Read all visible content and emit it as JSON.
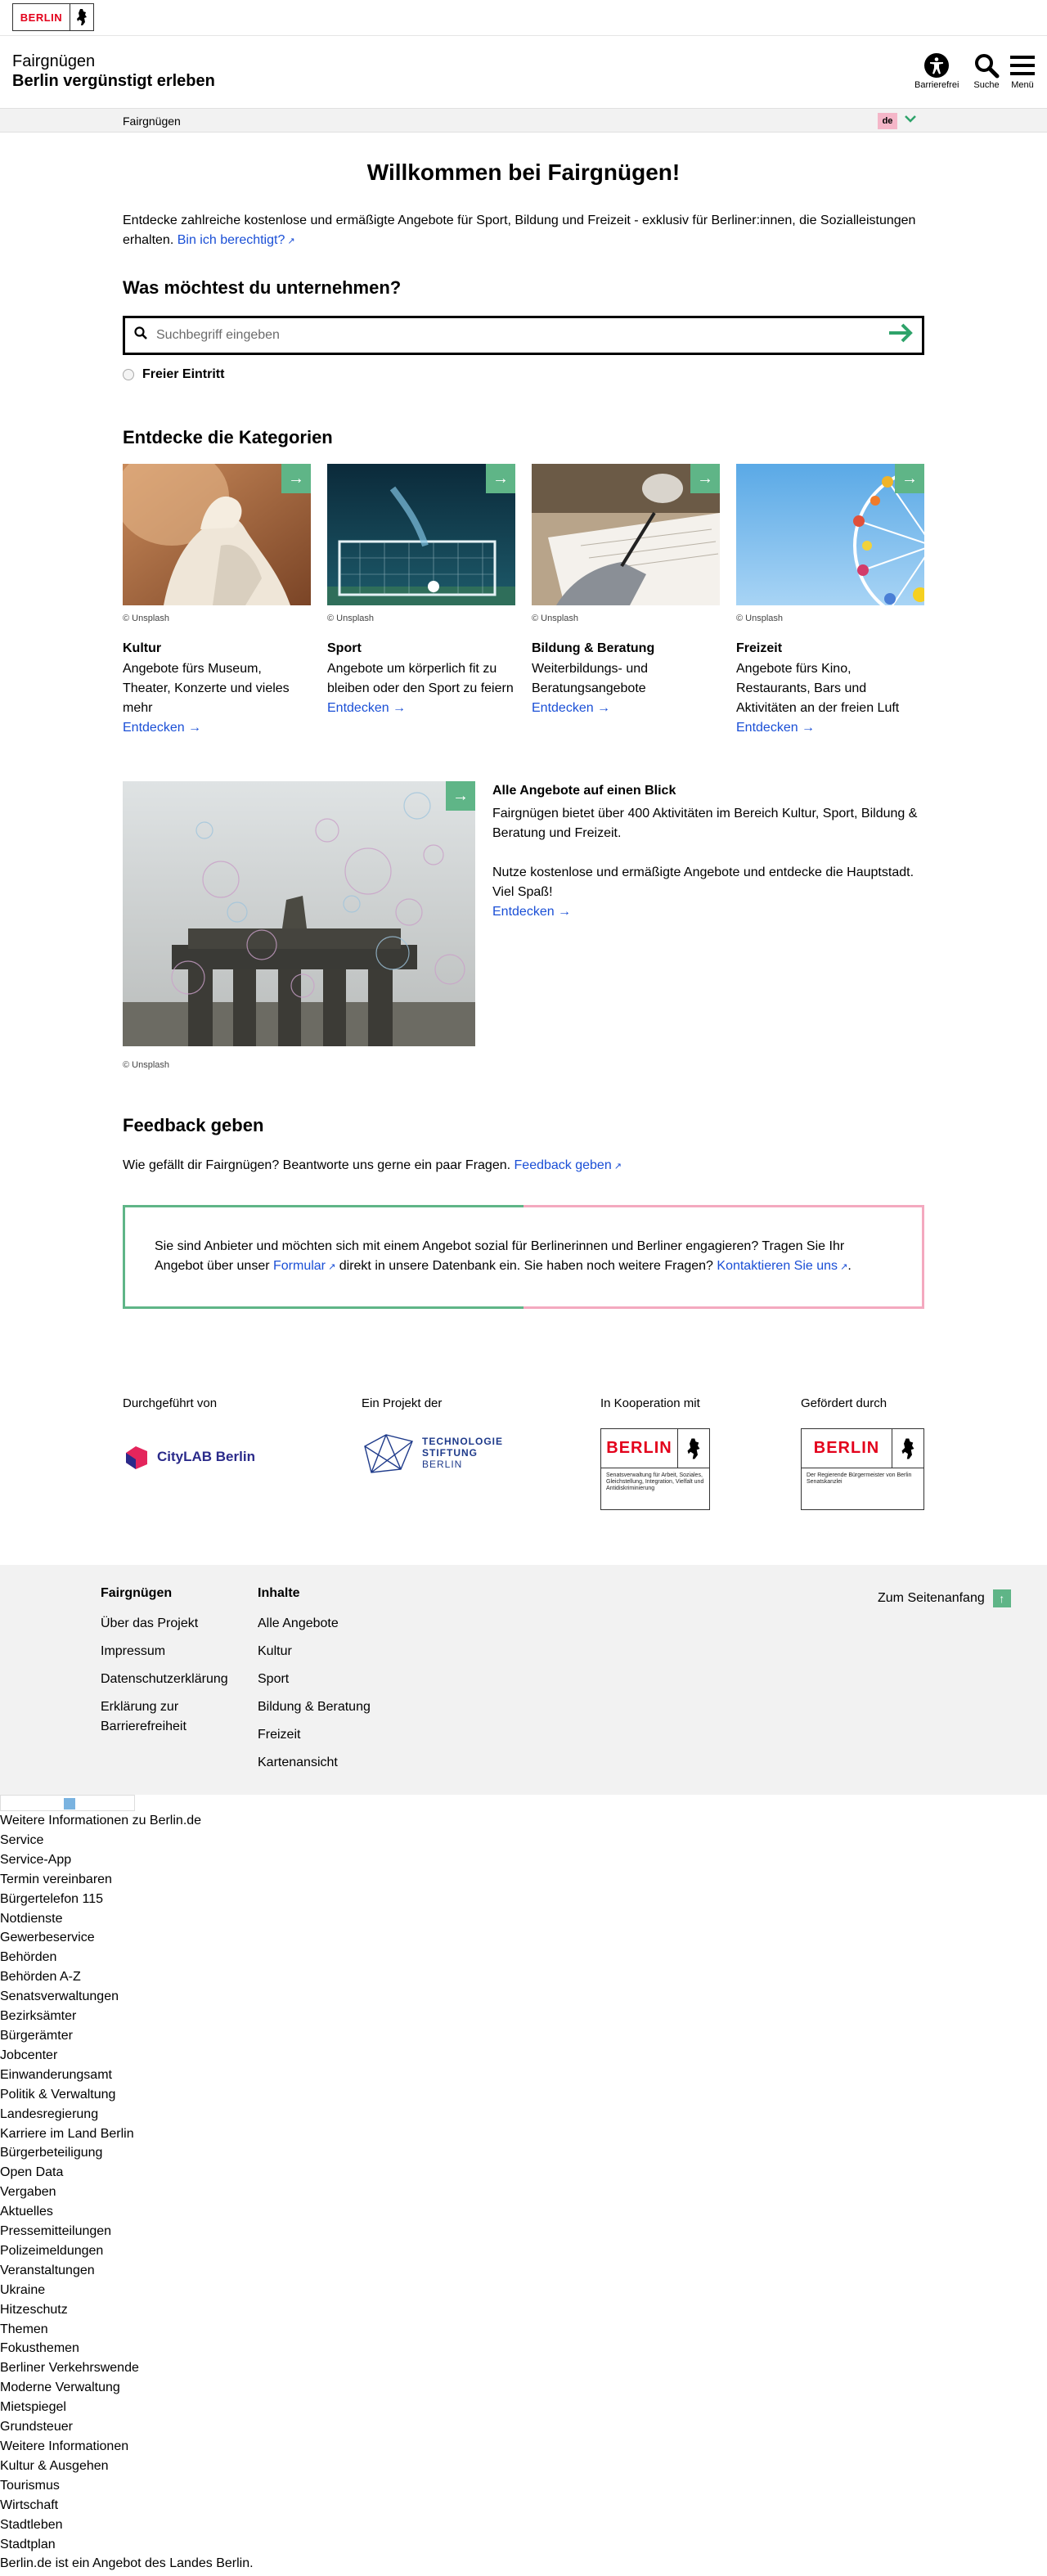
{
  "topbar": {
    "logo_word": "BERLIN"
  },
  "header": {
    "title": "Fairgnügen",
    "subtitle": "Berlin vergünstigt erleben",
    "buttons": {
      "accessibility": "Barrierefrei",
      "search": "Suche",
      "menu": "Menü"
    }
  },
  "breadcrumb": {
    "current": "Fairgnügen",
    "lang": "de"
  },
  "main": {
    "heading": "Willkommen bei Fairgnügen!",
    "intro": "Entdecke zahlreiche kostenlose und ermäßigte Angebote für Sport, Bildung und Freizeit - exklusiv für Berliner:innen, die Sozialleistungen erhalten.",
    "intro_link": "Bin ich berechtigt?",
    "search_heading": "Was möchtest du unternehmen?",
    "search_placeholder": "Suchbegriff eingeben",
    "free_entry_label": "Freier Eintritt",
    "categories_heading": "Entdecke die Kategorien"
  },
  "categories": [
    {
      "credit": "© Unsplash",
      "title": "Kultur",
      "desc": "Angebote fürs Museum, Theater, Konzerte und vieles mehr",
      "link": "Entdecken"
    },
    {
      "credit": "© Unsplash",
      "title": "Sport",
      "desc": "Angebote um körperlich fit zu bleiben oder den Sport zu feiern",
      "link": "Entdecken"
    },
    {
      "credit": "© Unsplash",
      "title": "Bildung & Beratung",
      "desc": "Weiterbildungs- und Beratungsangebote",
      "link": "Entdecken"
    },
    {
      "credit": "© Unsplash",
      "title": "Freizeit",
      "desc": "Angebote fürs Kino, Restaurants, Bars und Aktivitäten an der freien Luft",
      "link": "Entdecken"
    }
  ],
  "overview": {
    "credit": "© Unsplash",
    "title": "Alle Angebote auf einen Blick",
    "p1": "Fairgnügen bietet über 400 Aktivitäten im Bereich Kultur, Sport, Bildung & Beratung und Freizeit.",
    "p2": "Nutze kostenlose und ermäßigte Angebote und entdecke die Hauptstadt. Viel Spaß!",
    "link": "Entdecken"
  },
  "feedback": {
    "heading": "Feedback geben",
    "text": "Wie gefällt dir Fairgnügen? Beantworte uns gerne ein paar Fragen.",
    "link": "Feedback geben"
  },
  "provider_box": {
    "t1": "Sie sind Anbieter und möchten sich mit einem Angebot sozial für Berlinerinnen und Berliner engagieren? Tragen Sie Ihr Angebot über unser",
    "link1": "Formular",
    "t2": "direkt in unsere Datenbank ein. Sie haben noch weitere Fragen?",
    "link2": "Kontaktieren Sie uns",
    "t3": "."
  },
  "partners": {
    "label1": "Durchgeführt von",
    "citylab": "CityLAB Berlin",
    "label2": "Ein Projekt der",
    "tsb": [
      "TECHNOLOGIE",
      "STIFTUNG",
      "BERLIN"
    ],
    "label3": "In Kooperation mit",
    "coop_word": "BERLIN",
    "coop_text": "Senatsverwaltung für Arbeit, Soziales, Gleichstellung, Integration, Vielfalt und Antidiskriminierung",
    "label4": "Gefördert durch",
    "fund_word": "BERLIN",
    "fund_text": "Der Regierende Bürgermeister von Berlin Senatskanzlei"
  },
  "footer": {
    "col1_title": "Fairgnügen",
    "col1": [
      "Über das Projekt",
      "Impressum",
      "Datenschutzerklärung",
      "Erklärung zur Barrierefreiheit"
    ],
    "col2_title": "Inhalte",
    "col2": [
      "Alle Angebote",
      "Kultur",
      "Sport",
      "Bildung & Beratung",
      "Freizeit",
      "Kartenansicht"
    ],
    "to_top": "Zum Seitenanfang"
  },
  "berlin_links": [
    "Weitere Informationen zu Berlin.de",
    "Service",
    "Service-App",
    "Termin vereinbaren",
    "Bürgertelefon 115",
    "Notdienste",
    "Gewerbeservice",
    "Behörden",
    "Behörden A-Z",
    "Senatsverwaltungen",
    "Bezirksämter",
    "Bürgerämter",
    "Jobcenter",
    "Einwanderungsamt",
    "Politik & Verwaltung",
    "Landesregierung",
    "Karriere im Land Berlin",
    "Bürgerbeteiligung",
    "Open Data",
    "Vergaben",
    "Aktuelles",
    "Pressemitteilungen",
    "Polizeimeldungen",
    "Veranstaltungen",
    "Ukraine",
    "Hitzeschutz",
    "Themen",
    "Fokusthemen",
    "Berliner Verkehrswende",
    "Moderne Verwaltung",
    "Mietspiegel",
    "Grundsteuer",
    "Weitere Informationen",
    "Kultur & Ausgehen",
    "Tourismus",
    "Wirtschaft",
    "Stadtleben",
    "Stadtplan",
    "Berlin.de ist ein Angebot des Landes Berlin."
  ],
  "colors": {
    "accent_green": "#5fb587",
    "accent_pink": "#f4a9bf",
    "link_blue": "#1a4fd6",
    "berlin_red": "#e3001b"
  }
}
